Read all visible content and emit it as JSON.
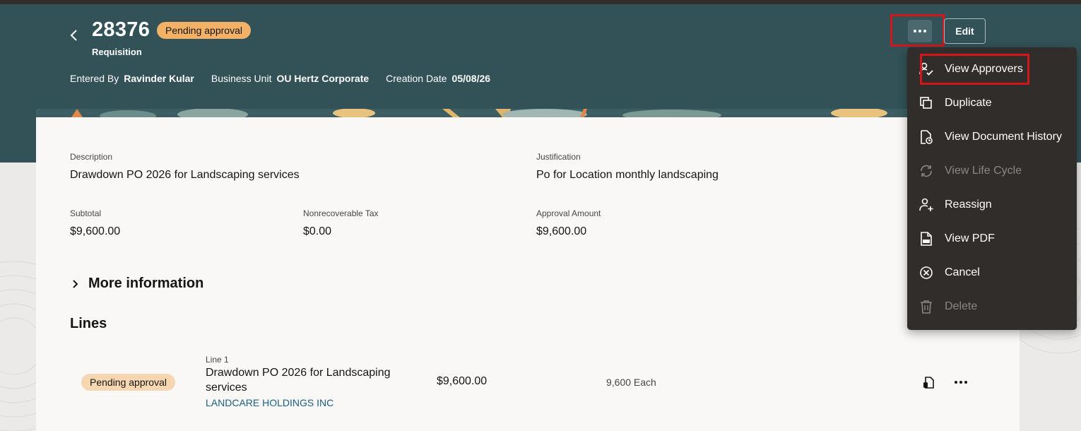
{
  "record": {
    "number": "28376",
    "status": "Pending approval",
    "type": "Requisition"
  },
  "meta": {
    "entered_by_label": "Entered By",
    "entered_by": "Ravinder Kular",
    "business_unit_label": "Business Unit",
    "business_unit": "OU Hertz Corporate",
    "creation_date_label": "Creation Date",
    "creation_date": "05/08/26"
  },
  "actions": {
    "edit_label": "Edit"
  },
  "details": {
    "description_label": "Description",
    "description": "Drawdown PO 2026 for Landscaping services",
    "justification_label": "Justification",
    "justification": "Po for Location monthly landscaping",
    "subtotal_label": "Subtotal",
    "subtotal": "$9,600.00",
    "tax_label": "Nonrecoverable Tax",
    "tax": "$0.00",
    "approval_amount_label": "Approval Amount",
    "approval_amount": "$9,600.00",
    "more_info_label": "More information"
  },
  "lines": {
    "heading": "Lines",
    "items": [
      {
        "status": "Pending approval",
        "line_label": "Line 1",
        "description": "Drawdown PO 2026 for Landscaping services",
        "supplier": "LANDCARE HOLDINGS INC",
        "amount": "$9,600.00",
        "quantity": "9,600 Each"
      }
    ]
  },
  "menu": {
    "items": [
      {
        "label": "View Approvers",
        "icon": "approvers-icon",
        "enabled": true
      },
      {
        "label": "Duplicate",
        "icon": "duplicate-icon",
        "enabled": true
      },
      {
        "label": "View Document History",
        "icon": "document-history-icon",
        "enabled": true
      },
      {
        "label": "View Life Cycle",
        "icon": "life-cycle-icon",
        "enabled": false
      },
      {
        "label": "Reassign",
        "icon": "reassign-icon",
        "enabled": true
      },
      {
        "label": "View PDF",
        "icon": "pdf-icon",
        "enabled": true
      },
      {
        "label": "Cancel",
        "icon": "cancel-icon",
        "enabled": true
      },
      {
        "label": "Delete",
        "icon": "trash-icon",
        "enabled": false
      }
    ]
  },
  "colors": {
    "header_bg": "#325258",
    "status_pill": "#f2b167",
    "menu_bg": "#312d2a",
    "highlight": "#d2161c",
    "link": "#1b5f85"
  }
}
